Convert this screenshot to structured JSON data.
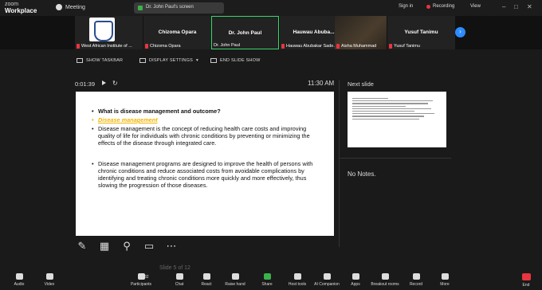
{
  "app": {
    "brand_top": "zoom",
    "brand_bottom": "Workplace",
    "meeting_label": "Meeting"
  },
  "screen_share_pill": "Dr. John Paul's screen",
  "top_right": {
    "signin": "Sign in",
    "recording": "Recording",
    "view": "View"
  },
  "participants": [
    {
      "center_name": "",
      "bottom_name": "West African Institute of ..."
    },
    {
      "center_name": "Chizoma Opara",
      "bottom_name": "Chizoma Opara"
    },
    {
      "center_name": "Dr. John Paul",
      "bottom_name": "Dr. John Paul"
    },
    {
      "center_name": "Hauwau Abuba...",
      "bottom_name": "Hauwau Abubakar Sade..."
    },
    {
      "center_name": "",
      "bottom_name": "Aisha Muhammad"
    },
    {
      "center_name": "Yusuf Tanimu",
      "bottom_name": "Yusuf Tanimu"
    }
  ],
  "presenter_toolbar": {
    "show_taskbar": "SHOW TASKBAR",
    "display_settings": "DISPLAY SETTINGS",
    "end_slide_show": "END SLIDE SHOW"
  },
  "presenter": {
    "timer": "0:01:39",
    "clock": "11:30 AM",
    "next_slide_label": "Next slide",
    "notes": "No Notes."
  },
  "slide": {
    "question": "What is disease management and outcome?",
    "heading": "Disease management",
    "para1": "Disease management is the concept of reducing health care costs and improving quality of life for individuals with chronic conditions by preventing or minimizing the effects of the disease through integrated care.",
    "para2": "Disease management programs are designed to improve the health of persons with chronic conditions and reduce associated costs from avoidable complications by identifying and treating chronic conditions more quickly and more effectively, thus slowing the progression of those diseases."
  },
  "slide_nav": "Slide 5 of 12",
  "controls": [
    {
      "label": "Audio",
      "icon": "mic-icon"
    },
    {
      "label": "Video",
      "icon": "video-icon"
    },
    {
      "label": "Participants",
      "icon": "participants-icon",
      "count": "32"
    },
    {
      "label": "Chat",
      "icon": "chat-icon"
    },
    {
      "label": "React",
      "icon": "react-icon"
    },
    {
      "label": "Raise hand",
      "icon": "raise-hand-icon"
    },
    {
      "label": "Share",
      "icon": "share-icon"
    },
    {
      "label": "Host tools",
      "icon": "host-tools-icon"
    },
    {
      "label": "AI Companion",
      "icon": "ai-companion-icon"
    },
    {
      "label": "Apps",
      "icon": "apps-icon"
    },
    {
      "label": "Breakout rooms",
      "icon": "breakout-rooms-icon"
    },
    {
      "label": "Record",
      "icon": "record-icon"
    },
    {
      "label": "More",
      "icon": "more-icon"
    },
    {
      "label": "End",
      "icon": "end-icon"
    }
  ],
  "colors": {
    "accent": "#2d8cff",
    "active_speaker": "#3bd46a",
    "recording": "#e8353f",
    "highlight_text": "#f0b400"
  }
}
